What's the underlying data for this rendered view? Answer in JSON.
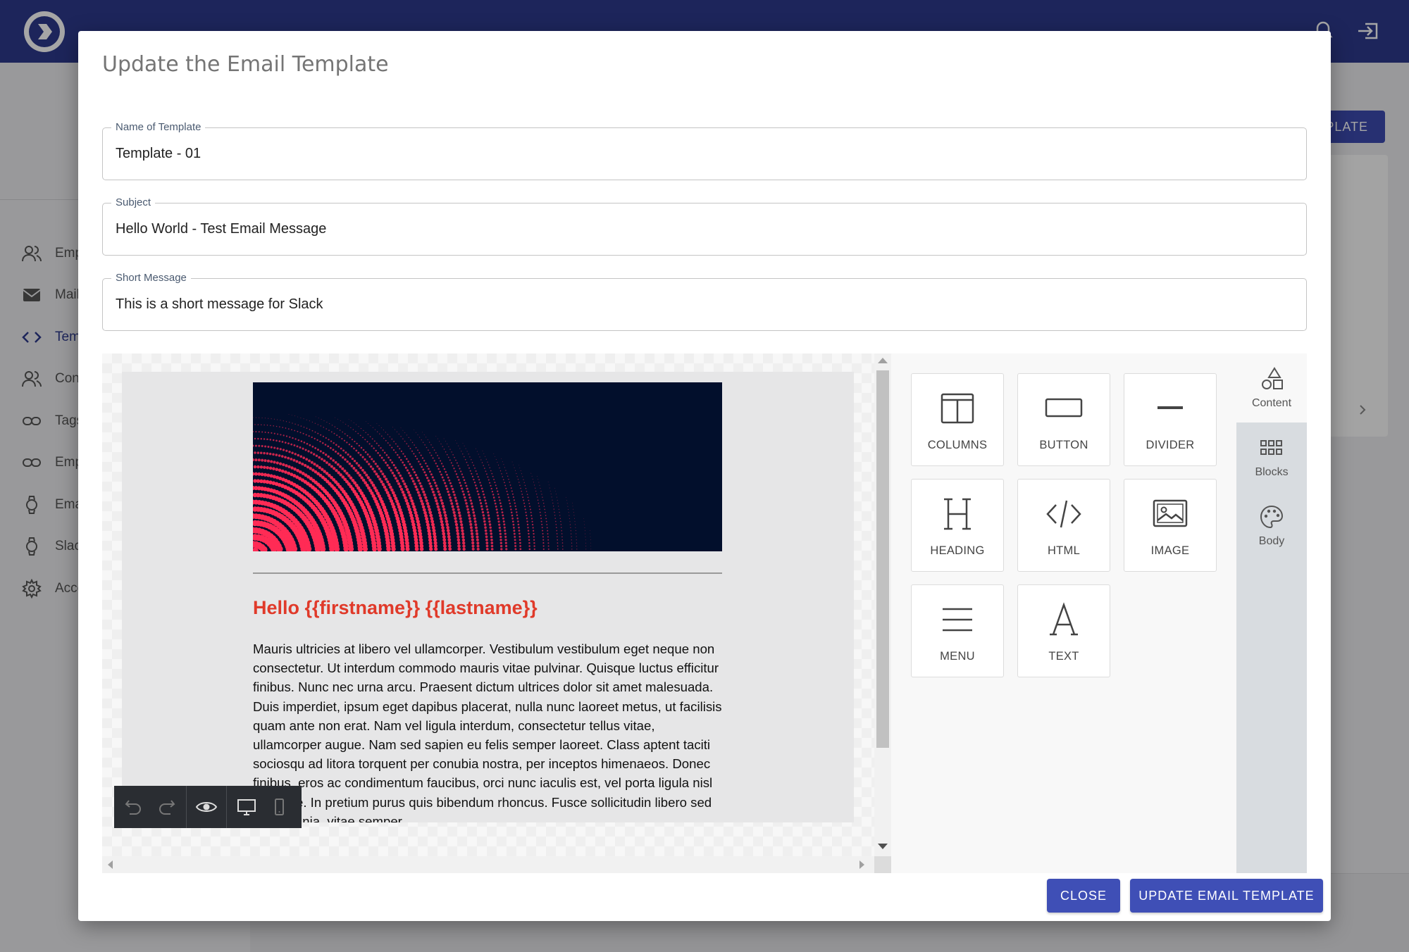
{
  "background": {
    "nav_items": [
      "Empl",
      "Mail",
      "Tem",
      "Cont",
      "Tags",
      "Emp",
      "Emai",
      "Slacl",
      "Acco"
    ],
    "top_button_label": "PLATE"
  },
  "modal": {
    "title": "Update the Email Template",
    "fields": {
      "name": {
        "label": "Name of Template",
        "value": "Template - 01"
      },
      "subject": {
        "label": "Subject",
        "value": "Hello World - Test Email Message"
      },
      "short_message": {
        "label": "Short Message",
        "value": "This is a short message for Slack"
      }
    },
    "editor": {
      "email_heading": "Hello {{firstname}} {{lastname}}",
      "email_text": "Mauris ultricies at libero vel ullamcorper. Vestibulum vestibulum eget neque non consectetur. Ut interdum commodo mauris vitae pulvinar. Quisque luctus efficitur finibus. Nunc nec urna arcu. Praesent dictum ultrices dolor sit amet malesuada. Duis imperdiet, ipsum eget dapibus placerat, nulla nunc laoreet metus, ut facilisis quam ante non erat. Nam vel ligula interdum, consectetur tellus vitae, ullamcorper augue. Nam sed sapien eu felis semper laoreet. Class aptent taciti sociosqu ad litora torquent per conubia nostra, per inceptos himenaeos. Donec finibus, eros ac condimentum faucibus, orci nunc iaculis est, vel porta ligula nisl id augue. In pretium purus quis bibendum rhoncus. Fusce sollicitudin libero sed urna lacinia, vitae semper",
      "tools": [
        {
          "label": "COLUMNS",
          "icon": "columns-icon"
        },
        {
          "label": "BUTTON",
          "icon": "button-icon"
        },
        {
          "label": "DIVIDER",
          "icon": "divider-icon"
        },
        {
          "label": "HEADING",
          "icon": "heading-icon"
        },
        {
          "label": "HTML",
          "icon": "code-icon"
        },
        {
          "label": "IMAGE",
          "icon": "image-icon"
        },
        {
          "label": "MENU",
          "icon": "menu-icon"
        },
        {
          "label": "TEXT",
          "icon": "text-icon"
        }
      ],
      "tabs": [
        {
          "label": "Content",
          "icon": "shapes-icon",
          "active": true
        },
        {
          "label": "Blocks",
          "icon": "grid-icon",
          "active": false
        },
        {
          "label": "Body",
          "icon": "palette-icon",
          "active": false
        }
      ]
    },
    "buttons": {
      "close": "CLOSE",
      "update": "UPDATE EMAIL TEMPLATE"
    }
  },
  "colors": {
    "header": "#2d3a8c",
    "primary_button": "#3f4fb6",
    "heading_red": "#e03a2a",
    "banner_bg": "#020f2c",
    "banner_dots": "#ff2b55"
  }
}
